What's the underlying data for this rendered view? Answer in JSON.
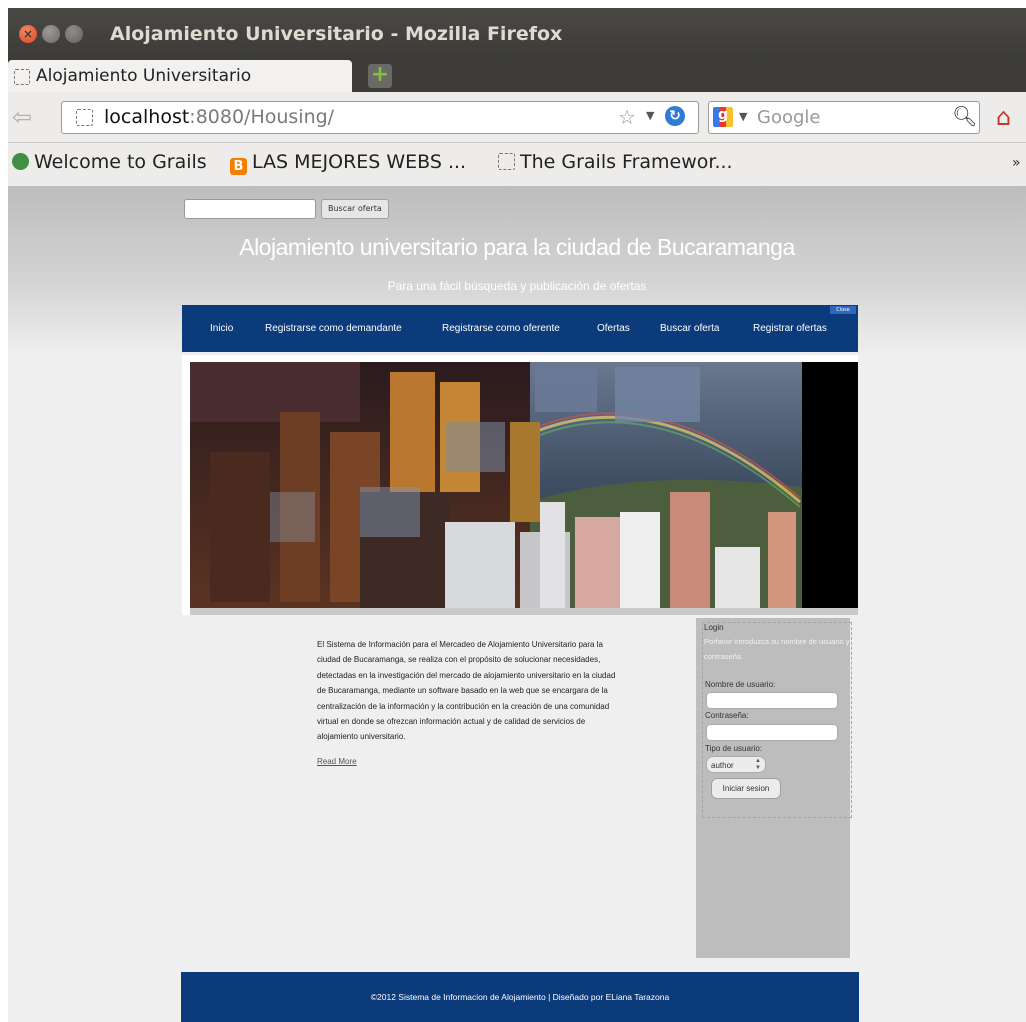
{
  "window": {
    "title": "Alojamiento Universitario - Mozilla Firefox"
  },
  "tabs": [
    {
      "label": "Alojamiento Universitario"
    }
  ],
  "navbar": {
    "url_host": "localhost",
    "url_rest": ":8080/Housing/",
    "search_placeholder": "Google"
  },
  "bookmarks": [
    {
      "label": "Welcome to Grails"
    },
    {
      "label": "LAS MEJORES WEBS ..."
    },
    {
      "label": "The Grails Framewor..."
    }
  ],
  "page": {
    "search_button": "Buscar oferta",
    "title": "Alojamiento universitario para la ciudad de Bucaramanga",
    "subtitle": "Para una fácil búsqueda y publicación de ofertas",
    "menu": [
      {
        "label": "Inicio"
      },
      {
        "label": "Registrarse como demandante"
      },
      {
        "label": "Registrarse como oferente"
      },
      {
        "label": "Ofertas"
      },
      {
        "label": "Buscar oferta"
      },
      {
        "label": "Registrar ofertas"
      }
    ],
    "menu_corner": "Close",
    "article": {
      "lines": [
        "El Sistema de Información para el Mercadeo de Alojamiento Universitario para la",
        "ciudad de Bucaramanga, se realiza con el propósito de solucionar necesidades,",
        "detectadas en la investigación del mercado de alojamiento universitario en la ciudad",
        "de Bucaramanga, mediante un software basado en la web que se encargara de la",
        "centralización de la información y la contribución en la creación de una comunidad",
        "virtual en donde se ofrezcan información actual y de calidad de servicios de",
        "alojamiento universitario."
      ],
      "read_more": "Read More"
    },
    "login": {
      "title": "Login",
      "hint": "Porfavor introduzca su nombre de usuario y contraseña.",
      "username_label": "Nombre de usuario:",
      "password_label": "Contraseña:",
      "type_label": "Tipo de usuario:",
      "type_value": "author",
      "submit": "Iniciar sesion"
    },
    "footer": "©2012 Sistema de Informacion de Alojamiento | Diseñado por ELiana Tarazona"
  },
  "colors": {
    "menu_bg": "#0b3b7a",
    "titlebar": "#3c3b37",
    "sidebar": "#bdbdbd"
  }
}
